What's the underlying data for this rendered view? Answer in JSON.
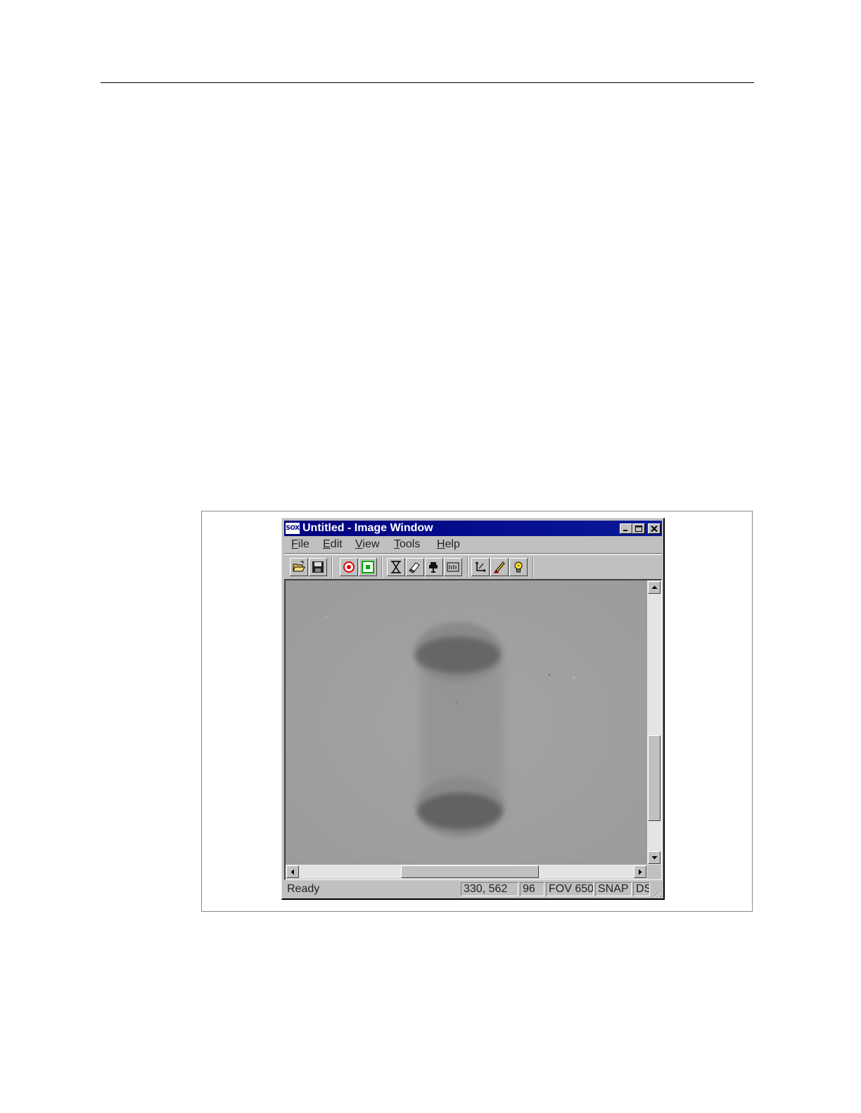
{
  "window": {
    "app_icon": "SOX",
    "title": "Untitled - Image Window"
  },
  "title_buttons": {
    "minimize": "minimize-icon",
    "maximize": "maximize-icon",
    "close": "close-icon"
  },
  "menu": {
    "items": [
      "File",
      "Edit",
      "View",
      "Tools",
      "Help"
    ]
  },
  "toolbar": {
    "icons": [
      "open-folder-icon",
      "save-disk-icon",
      "record-red-icon",
      "record-green-icon",
      "hourglass-icon",
      "eraser-icon",
      "camera-icon",
      "ruler-icon",
      "axes-icon",
      "pencil-icon",
      "lightbulb-icon"
    ]
  },
  "status": {
    "message": "Ready",
    "coordinates": "330, 562",
    "value": "96",
    "fov": "FOV 650",
    "mode": "SNAP",
    "extra": "DS"
  },
  "colors": {
    "titlebar": "#000080",
    "window_face": "#c0c0c0",
    "image_background": "#a0a0a0"
  }
}
